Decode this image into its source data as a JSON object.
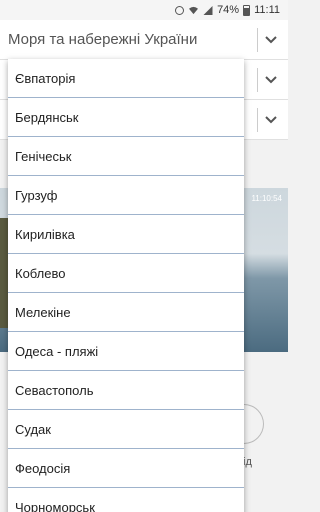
{
  "status_bar": {
    "battery_text": "74%",
    "time": "11:11",
    "icons": [
      "alarm-icon",
      "wifi-icon",
      "signal-icon",
      "battery-icon"
    ]
  },
  "header_select": {
    "label": "Моря та набережні України"
  },
  "photo": {
    "timestamp": "11:10:54"
  },
  "partial_text": "ід",
  "dropdown": {
    "items": [
      "Євпаторія",
      "Бердянськ",
      "Генічеськ",
      "Гурзуф",
      "Кирилівка",
      "Коблево",
      "Мелекіне",
      "Одеса - пляжі",
      "Севастополь",
      "Судак",
      "Феодосія",
      "Чорноморськ"
    ]
  },
  "colors": {
    "divider": "#9fb3cc",
    "background": "#f2f2f2"
  }
}
